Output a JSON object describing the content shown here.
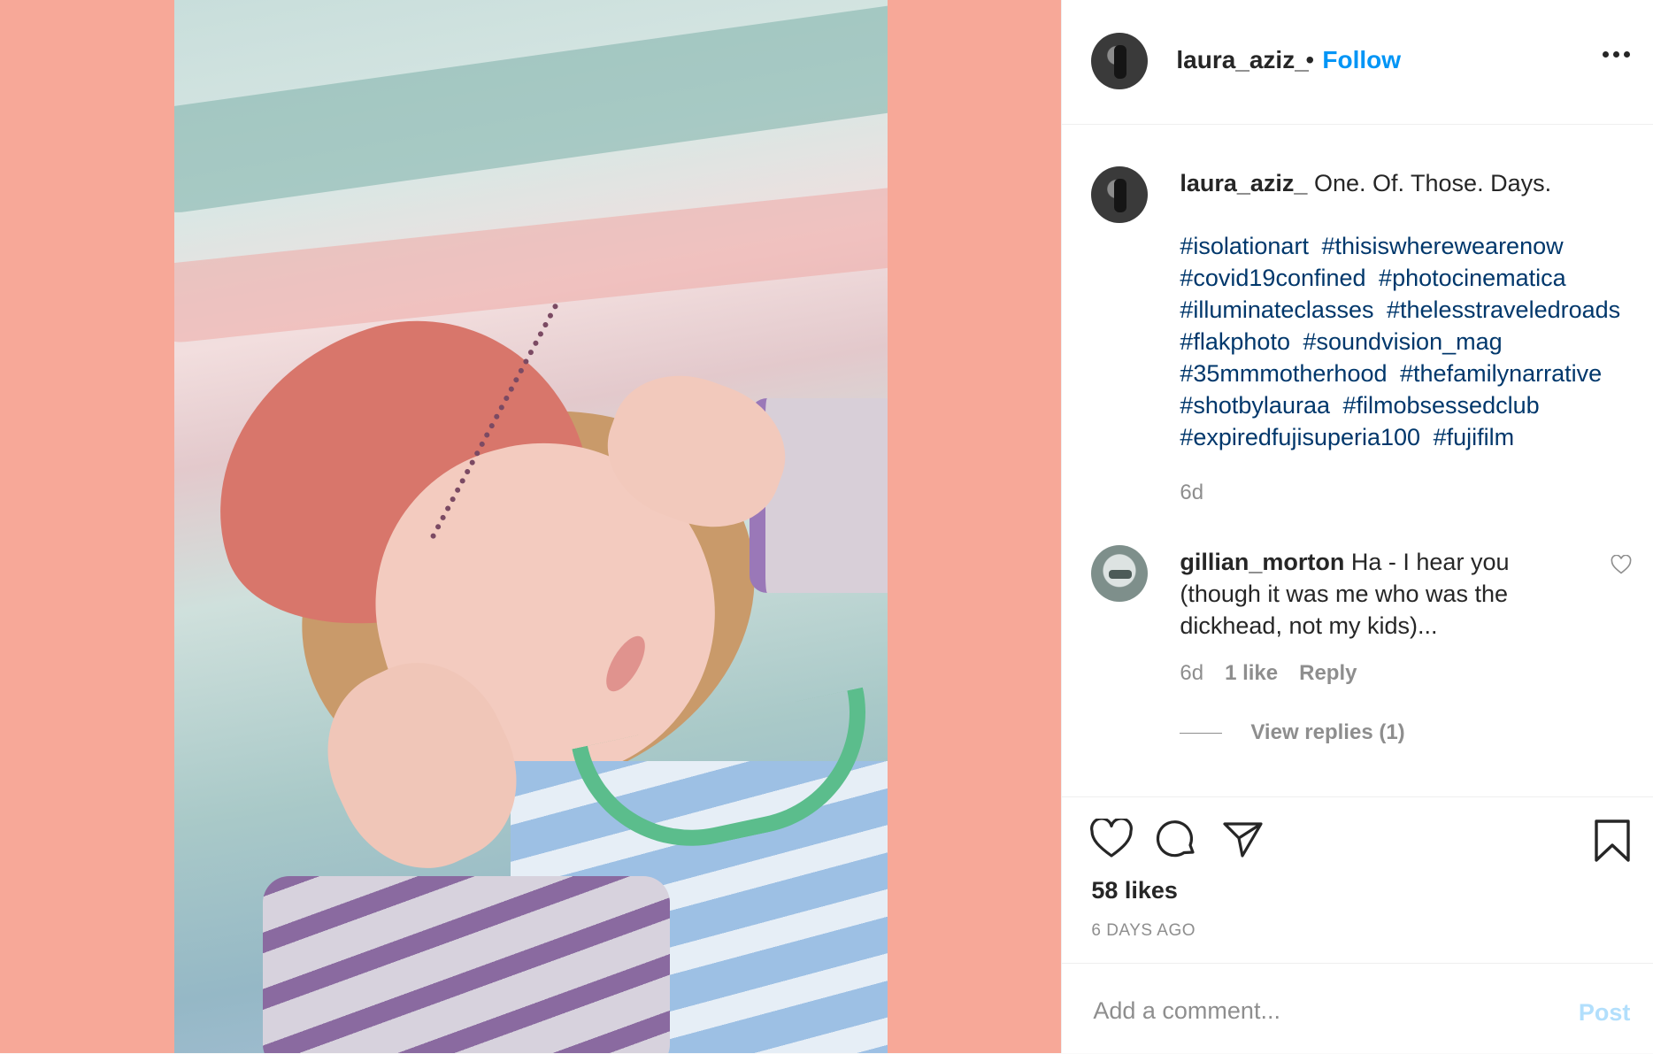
{
  "header": {
    "username": "laura_aziz_",
    "separator": "•",
    "follow_label": "Follow"
  },
  "caption": {
    "username": "laura_aziz_",
    "text": "One. Of. Those. Days.",
    "hashtags": [
      "#isolationart",
      "#thisiswherewearenow",
      "#covid19confined",
      "#photocinematica",
      "#illuminateclasses",
      "#thelesstraveledroads",
      "#flakphoto",
      "#soundvision_mag",
      "#35mmmotherhood",
      "#thefamilynarrative",
      "#shotbylauraa",
      "#filmobsessedclub",
      "#expiredfujisuperia100",
      "#fujifilm"
    ],
    "time": "6d"
  },
  "comment": {
    "username": "gillian_morton",
    "text": "Ha - I hear you (though it was me who was the dickhead, not my kids)...",
    "time": "6d",
    "likes": "1 like",
    "reply_label": "Reply",
    "view_replies": "View replies (1)"
  },
  "actions": {
    "icons": [
      "heart-icon",
      "comment-icon",
      "share-icon",
      "bookmark-icon"
    ]
  },
  "likes_text": "58 likes",
  "date_text": "6 DAYS AGO",
  "add_comment": {
    "placeholder": "Add a comment...",
    "post_label": "Post"
  },
  "colors": {
    "link": "#0095f6",
    "hashtag": "#00376b",
    "muted": "#8e8e8e",
    "backdrop": "#f7a898"
  }
}
